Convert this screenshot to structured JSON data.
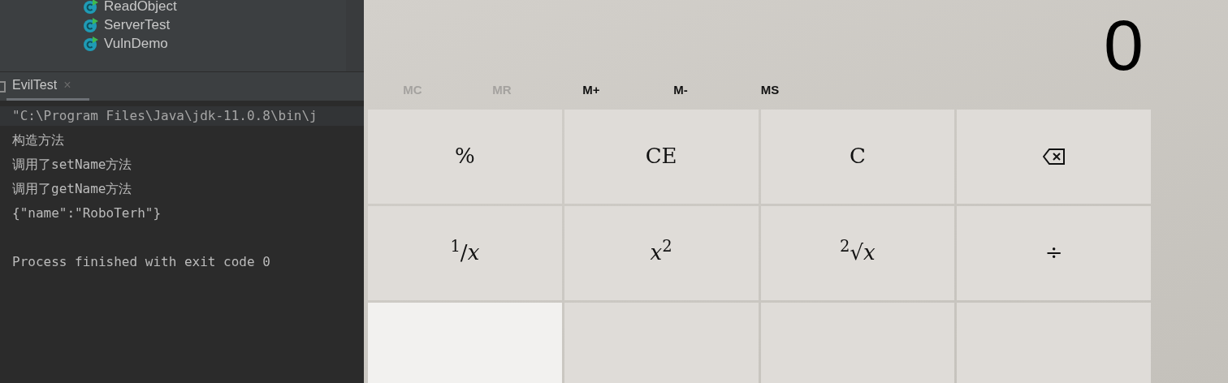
{
  "project_tree": {
    "items": [
      {
        "label": "ReadObject"
      },
      {
        "label": "ServerTest"
      },
      {
        "label": "VulnDemo"
      }
    ]
  },
  "run_tabs": [
    {
      "label": "EvilTest",
      "selected": true,
      "close": "×"
    }
  ],
  "console": {
    "lines": [
      {
        "kind": "command",
        "text": "\"C:\\Program Files\\Java\\jdk-11.0.8\\bin\\j"
      },
      {
        "kind": "output",
        "text": "构造方法"
      },
      {
        "kind": "output",
        "text": "调用了setName方法"
      },
      {
        "kind": "output",
        "text": "调用了getName方法"
      },
      {
        "kind": "output",
        "text": "{\"name\":\"RoboTerh\"}"
      },
      {
        "kind": "blank"
      },
      {
        "kind": "output",
        "text": "Process finished with exit code 0"
      }
    ]
  },
  "calculator": {
    "display": "0",
    "memory": [
      {
        "label": "MC",
        "disabled": true
      },
      {
        "label": "MR",
        "disabled": true
      },
      {
        "label": "M+",
        "disabled": false
      },
      {
        "label": "M-",
        "disabled": false
      },
      {
        "label": "MS",
        "disabled": false
      }
    ],
    "keys": [
      {
        "kind": "function",
        "label": "%"
      },
      {
        "kind": "function",
        "label": "CE"
      },
      {
        "kind": "function",
        "label": "C"
      },
      {
        "kind": "backspace"
      },
      {
        "kind": "function",
        "label": "$^{1}$/*x*"
      },
      {
        "kind": "function",
        "label": "*x*$^{2}$"
      },
      {
        "kind": "function",
        "label": "$^{2}$√*x*"
      },
      {
        "kind": "function",
        "label": "÷"
      },
      {
        "kind": "digit"
      },
      {
        "kind": "function"
      },
      {
        "kind": "function"
      },
      {
        "kind": "function"
      }
    ]
  }
}
